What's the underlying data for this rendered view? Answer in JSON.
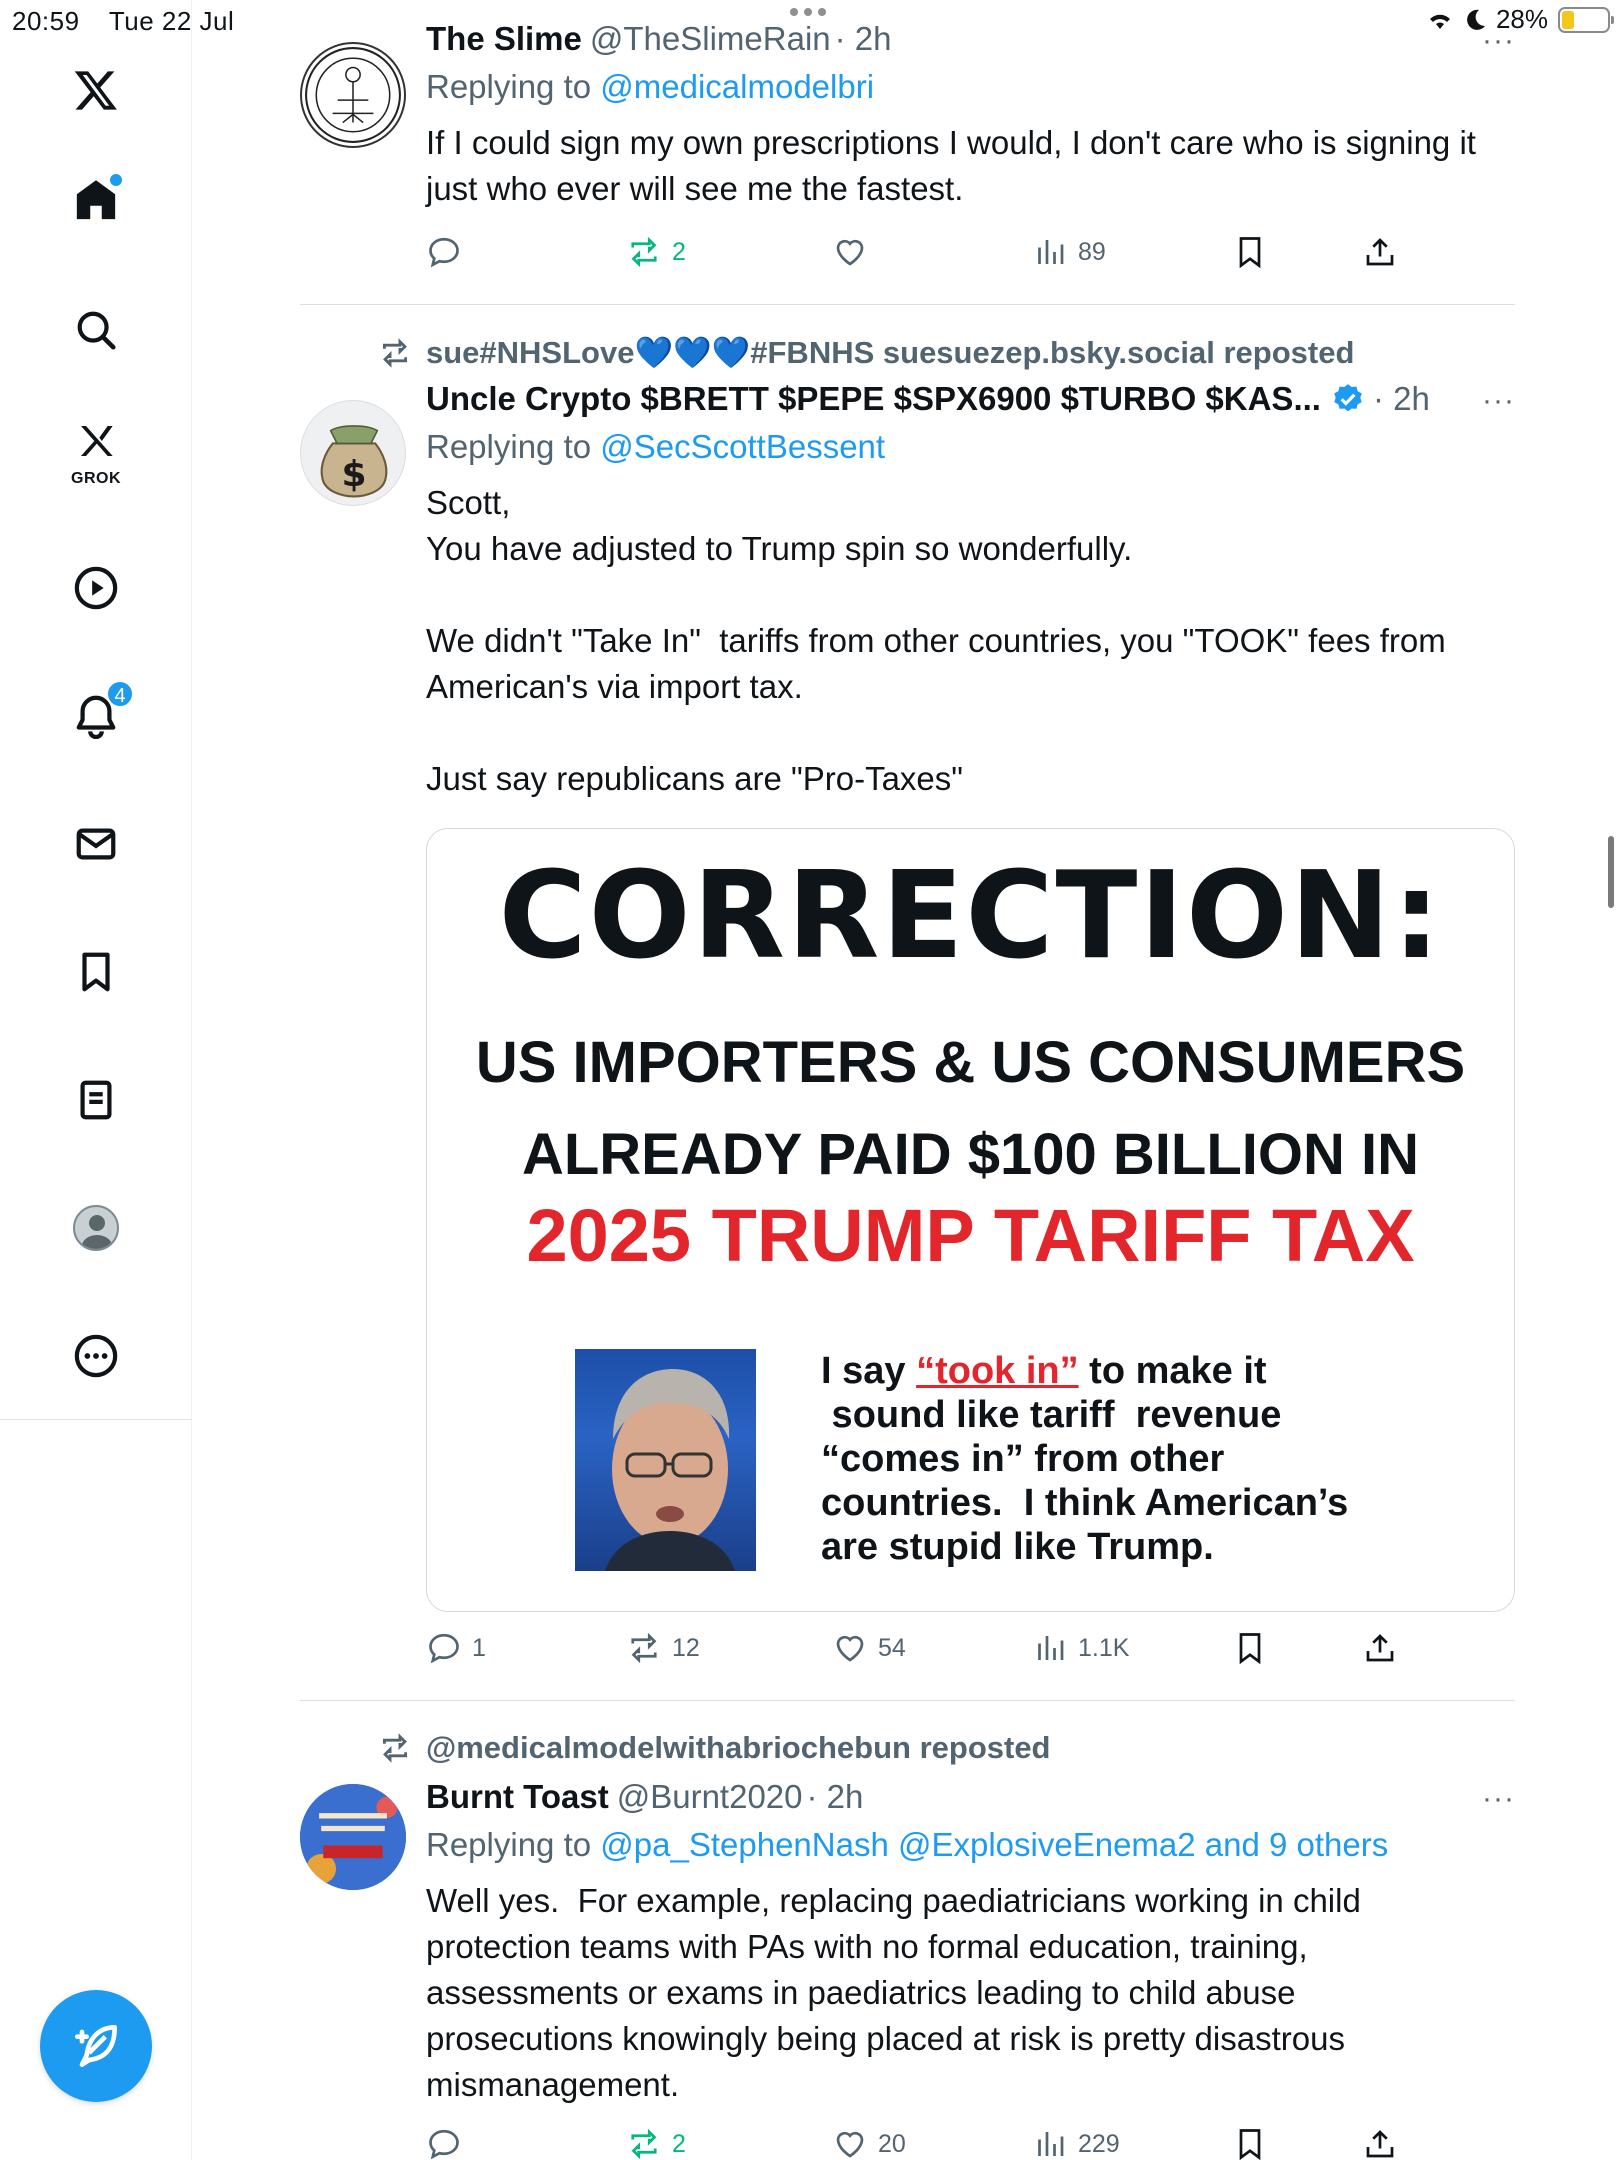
{
  "status": {
    "time": "20:59",
    "date": "Tue 22 Jul",
    "battery": "28%"
  },
  "sidebar": {
    "grok_label": "GROK",
    "notification_count": "4"
  },
  "posts": [
    {
      "repost_by": "",
      "name": "The Slime",
      "handle": "@TheSlimeRain",
      "time": "· 2h",
      "reply_prefix": "Replying to ",
      "reply_to": "@medicalmodelbri",
      "body": "If I could sign my own prescriptions I would, I don't care who is signing it\njust who ever will see me the fastest.",
      "replies": "",
      "reposts": "2",
      "likes": "",
      "views": "89"
    },
    {
      "repost_by": "sue#NHSLove💙💙💙#FBNHS suesuezep.bsky.social reposted",
      "name": "Uncle Crypto $BRETT $PEPE $SPX6900 $TURBO $KAS...",
      "handle": "",
      "time": "· 2h",
      "reply_prefix": "Replying to ",
      "reply_to": "@SecScottBessent",
      "body": "Scott,\nYou have adjusted to Trump spin so wonderfully.\n\nWe didn't \"Take In\"  tariffs from other countries, you \"TOOK\" fees from\nAmerican's via import tax.\n\nJust say republicans are \"Pro-Taxes\"",
      "replies": "1",
      "reposts": "12",
      "likes": "54",
      "views": "1.1K",
      "media": {
        "title": "CORRECTION:",
        "line1": "US IMPORTERS &  US CONSUMERS",
        "line2": "ALREADY PAID $100 BILLION IN",
        "line3": "2025 TRUMP TARIFF TAX",
        "quote_pre": "I say ",
        "quote_ul": "“took in”",
        "quote_post": " to make it\n sound like tariff  revenue\n“comes in” from other\ncountries.  I think American’s\nare stupid like Trump."
      }
    },
    {
      "repost_by": "@medicalmodelwithabriochebun reposted",
      "name": "Burnt Toast",
      "handle": "@Burnt2020",
      "time": "· 2h",
      "reply_prefix": "Replying to ",
      "reply_to": "@pa_StephenNash @ExplosiveEnema2 and 9 others",
      "body": "Well yes.  For example, replacing paediatricians working in child\nprotection teams with PAs with no formal education, training,\nassessments or exams in paediatrics leading to child abuse\nprosecutions knowingly being placed at risk is pretty disastrous\nmismanagement.",
      "replies": "",
      "reposts": "2",
      "likes": "20",
      "views": "229"
    }
  ],
  "colors": {
    "accent": "#1d9bf0",
    "secondary_text": "#536471",
    "repost_green": "#00ba7c",
    "headline_red": "#e3262b"
  }
}
